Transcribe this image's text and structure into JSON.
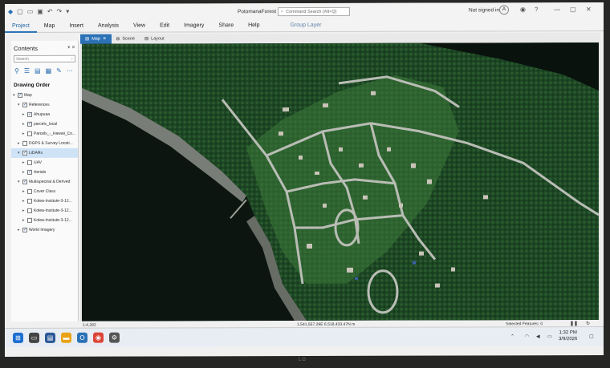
{
  "app": {
    "title": "PotomanaForest",
    "search_placeholder": "Command Search (Alt+Q)",
    "signin": "Not signed in",
    "user_initial": "A"
  },
  "ribbon": {
    "tabs": [
      "Project",
      "Map",
      "Insert",
      "Analysis",
      "View",
      "Edit",
      "Imagery",
      "Share",
      "Help"
    ],
    "context_tab": "Group Layer"
  },
  "contents": {
    "title": "Contents",
    "search_placeholder": "Search",
    "drawing_order": "Drawing Order",
    "layers": [
      {
        "label": "Map",
        "indent": 0,
        "checked": true,
        "expanded": true
      },
      {
        "label": "References",
        "indent": 1,
        "checked": true,
        "expanded": true
      },
      {
        "label": "Ahupuaa",
        "indent": 2,
        "checked": true,
        "expanded": false
      },
      {
        "label": "parcels_local",
        "indent": 2,
        "checked": true,
        "expanded": false
      },
      {
        "label": "Parcels_-_Hawaii_Co...",
        "indent": 2,
        "checked": false,
        "expanded": false
      },
      {
        "label": "DGPS & Survey Locati...",
        "indent": 1,
        "checked": false,
        "expanded": false
      },
      {
        "label": "LiDARs",
        "indent": 1,
        "checked": true,
        "expanded": true,
        "selected": true
      },
      {
        "label": "UAV",
        "indent": 2,
        "checked": false,
        "expanded": false
      },
      {
        "label": "Aerials",
        "indent": 2,
        "checked": true,
        "expanded": false
      },
      {
        "label": "Multispectral & Derived",
        "indent": 1,
        "checked": true,
        "expanded": true
      },
      {
        "label": "Cover Class",
        "indent": 2,
        "checked": false,
        "expanded": false
      },
      {
        "label": "Kolea-Institute-3-12...",
        "indent": 2,
        "checked": false,
        "expanded": false
      },
      {
        "label": "Kolea-Institute-3-12...",
        "indent": 2,
        "checked": false,
        "expanded": false
      },
      {
        "label": "Kolea-Institute-3-12...",
        "indent": 2,
        "checked": false,
        "expanded": false
      },
      {
        "label": "World Imagery",
        "indent": 1,
        "checked": true,
        "expanded": false
      }
    ]
  },
  "views": {
    "tabs": [
      {
        "label": "Map",
        "active": true
      },
      {
        "label": "Scene",
        "active": false
      },
      {
        "label": "Layout",
        "active": false
      }
    ]
  },
  "status": {
    "scale": "1:4,282",
    "coordinates": "1,541,557.29E 6,518,433.47N m",
    "selected_features": "Selected Features: 0"
  },
  "taskbar": {
    "time": "1:32 PM",
    "date": "3/9/2026"
  },
  "monitor_brand": "LG",
  "colors": {
    "accent": "#2b72b6",
    "forest": "#1f4a25",
    "water": "#0d1612",
    "road": "#b9bdb5"
  }
}
